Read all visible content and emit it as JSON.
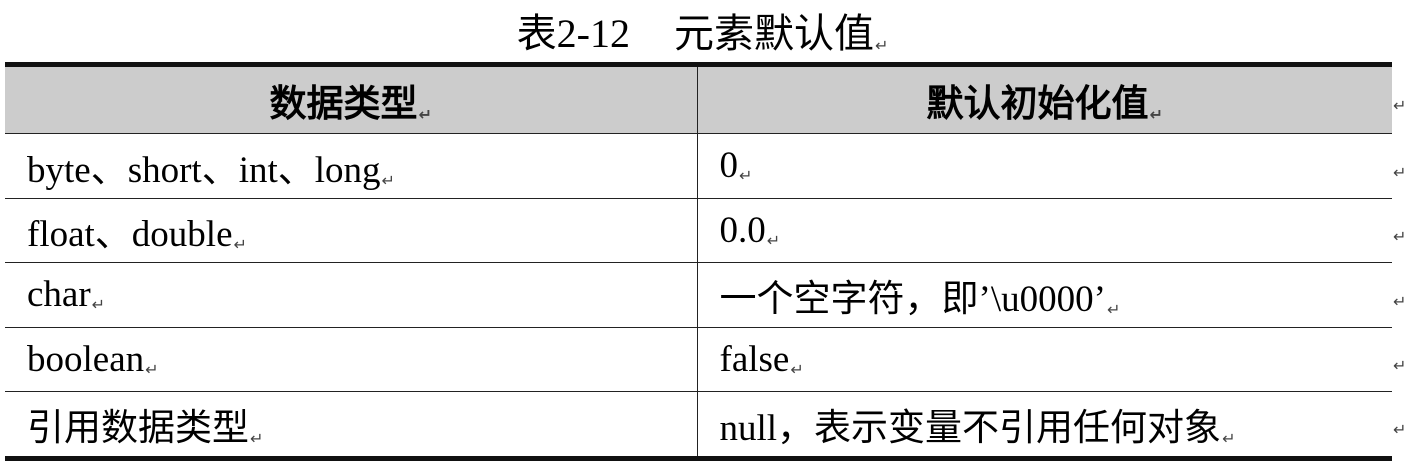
{
  "caption": {
    "number": "表2-12",
    "title": "元素默认值"
  },
  "table": {
    "headers": [
      "数据类型",
      "默认初始化值"
    ],
    "rows": [
      [
        "byte、short、int、long",
        "0"
      ],
      [
        "float、double",
        "0.0"
      ],
      [
        "char",
        "一个空字符，即’\\u0000’"
      ],
      [
        "boolean",
        "false"
      ],
      [
        "引用数据类型",
        "null，表示变量不引用任何对象"
      ]
    ]
  },
  "paragraph_mark": "↵"
}
